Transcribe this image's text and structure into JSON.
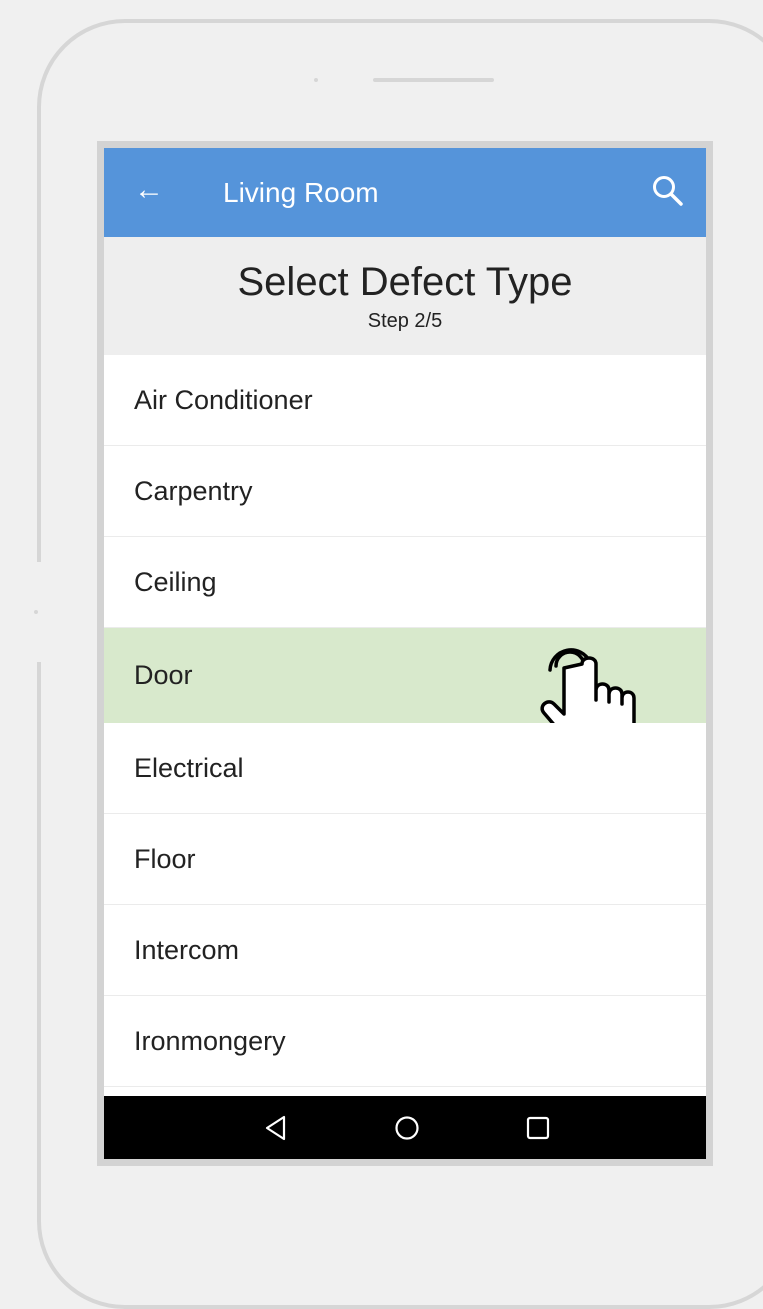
{
  "app_bar": {
    "title": "Living Room",
    "back_icon": "arrow-left-icon",
    "search_icon": "search-icon",
    "color": "#5594da"
  },
  "header": {
    "title": "Select Defect Type",
    "step": "Step 2/5"
  },
  "defect_types": [
    {
      "label": "Air Conditioner",
      "selected": false
    },
    {
      "label": "Carpentry",
      "selected": false
    },
    {
      "label": "Ceiling",
      "selected": false
    },
    {
      "label": "Door",
      "selected": true
    },
    {
      "label": "Electrical",
      "selected": false
    },
    {
      "label": "Floor",
      "selected": false
    },
    {
      "label": "Intercom",
      "selected": false
    },
    {
      "label": "Ironmongery",
      "selected": false
    }
  ],
  "selected_color": "#d8e9cc",
  "nav_bar": {
    "icons": [
      "back-triangle-icon",
      "home-circle-icon",
      "recents-square-icon"
    ]
  }
}
